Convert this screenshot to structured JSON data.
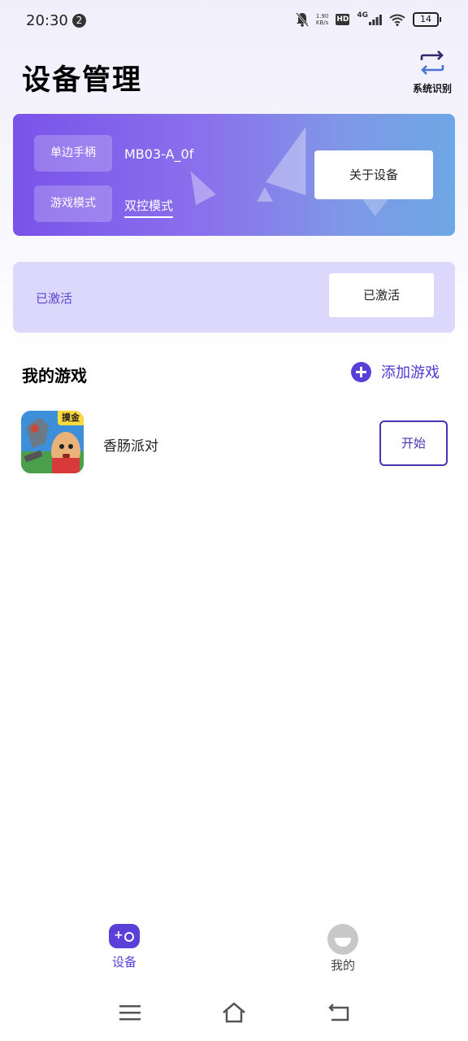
{
  "status_bar": {
    "time": "20:30",
    "notification_count": "2",
    "net_speed_value": "1.90",
    "net_speed_unit": "KB/s",
    "hd_label": "HD",
    "signal_label": "4G",
    "battery": "14"
  },
  "header": {
    "title": "设备管理",
    "system_recognition_label": "系统识别"
  },
  "device_card": {
    "controller_type_label": "单边手柄",
    "device_name": "MB03-A_0f",
    "game_mode_label": "游戏模式",
    "game_mode_value": "双控模式",
    "about_button": "关于设备"
  },
  "activation_card": {
    "status_text": "已激活",
    "button_label": "已激活"
  },
  "my_games": {
    "section_title": "我的游戏",
    "add_game_label": "添加游戏",
    "games": [
      {
        "badge": "摸金",
        "name": "香肠派对",
        "start_label": "开始"
      }
    ]
  },
  "bottom_nav": {
    "items": [
      {
        "label": "设备",
        "icon": "gamepad-icon",
        "active": true
      },
      {
        "label": "我的",
        "icon": "avatar-icon",
        "active": false
      }
    ]
  },
  "colors": {
    "accent": "#5b3fd9",
    "card_gradient_start": "#7a53ea",
    "card_gradient_end": "#6ea7e6",
    "activation_bg": "#dcd8fb"
  }
}
